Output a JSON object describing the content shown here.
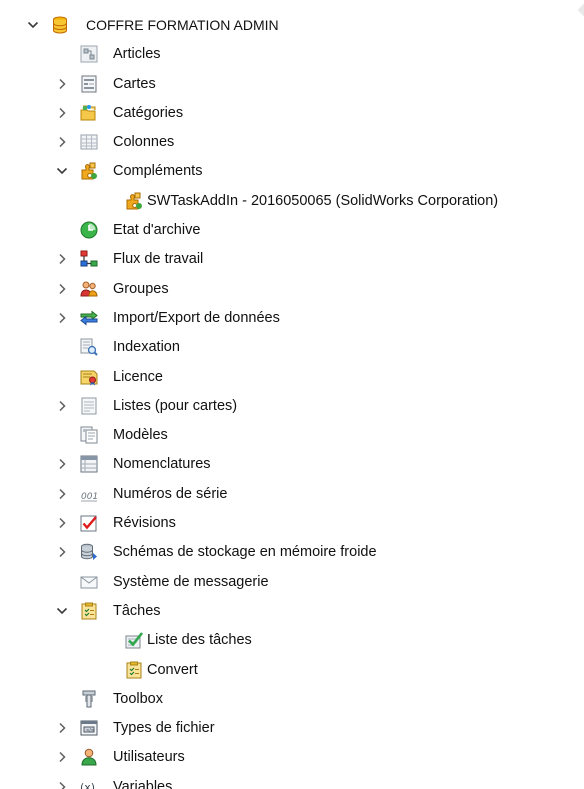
{
  "tree": {
    "root": {
      "label": "COFFRE FORMATION ADMIN",
      "icon": "vault-database-icon"
    },
    "items": [
      {
        "label": "Articles",
        "icon": "articles-icon",
        "expander": "none"
      },
      {
        "label": "Cartes",
        "icon": "cards-icon",
        "expander": "collapsed"
      },
      {
        "label": "Catégories",
        "icon": "categories-icon",
        "expander": "collapsed"
      },
      {
        "label": "Colonnes",
        "icon": "columns-icon",
        "expander": "collapsed"
      },
      {
        "label": "Compléments",
        "icon": "addins-puzzle-icon",
        "expander": "expanded"
      },
      {
        "label": "SWTaskAddIn - 2016050065 (SolidWorks Corporation)",
        "icon": "addin-puzzle-icon",
        "expander": "none",
        "level": 2
      },
      {
        "label": "Etat d'archive",
        "icon": "archive-state-icon",
        "expander": "none"
      },
      {
        "label": "Flux de travail",
        "icon": "workflow-icon",
        "expander": "collapsed"
      },
      {
        "label": "Groupes",
        "icon": "groups-icon",
        "expander": "collapsed"
      },
      {
        "label": "Import/Export de données",
        "icon": "import-export-icon",
        "expander": "collapsed"
      },
      {
        "label": "Indexation",
        "icon": "indexing-icon",
        "expander": "none"
      },
      {
        "label": "Licence",
        "icon": "license-icon",
        "expander": "none"
      },
      {
        "label": "Listes (pour cartes)",
        "icon": "lists-icon",
        "expander": "collapsed"
      },
      {
        "label": "Modèles",
        "icon": "templates-icon",
        "expander": "none"
      },
      {
        "label": "Nomenclatures",
        "icon": "bom-icon",
        "expander": "collapsed"
      },
      {
        "label": "Numéros de série",
        "icon": "serial-numbers-icon",
        "expander": "collapsed"
      },
      {
        "label": "Révisions",
        "icon": "revisions-check-icon",
        "expander": "collapsed"
      },
      {
        "label": "Schémas de stockage en mémoire froide",
        "icon": "cold-storage-icon",
        "expander": "collapsed"
      },
      {
        "label": "Système de messagerie",
        "icon": "messaging-envelope-icon",
        "expander": "none"
      },
      {
        "label": "Tâches",
        "icon": "tasks-clipboard-icon",
        "expander": "expanded"
      },
      {
        "label": "Liste des tâches",
        "icon": "task-list-check-icon",
        "expander": "none",
        "level": 2
      },
      {
        "label": "Convert",
        "icon": "task-clipboard-icon",
        "expander": "none",
        "level": 2
      },
      {
        "label": "Toolbox",
        "icon": "toolbox-bolt-icon",
        "expander": "none"
      },
      {
        "label": "Types de fichier",
        "icon": "file-types-icon",
        "expander": "collapsed"
      },
      {
        "label": "Utilisateurs",
        "icon": "user-icon",
        "expander": "collapsed"
      },
      {
        "label": "Variables",
        "icon": "variables-icon",
        "expander": "collapsed"
      }
    ]
  },
  "colors": {
    "background": "#ffffff",
    "chevron": "#5f5f5f",
    "text": "#111111"
  }
}
